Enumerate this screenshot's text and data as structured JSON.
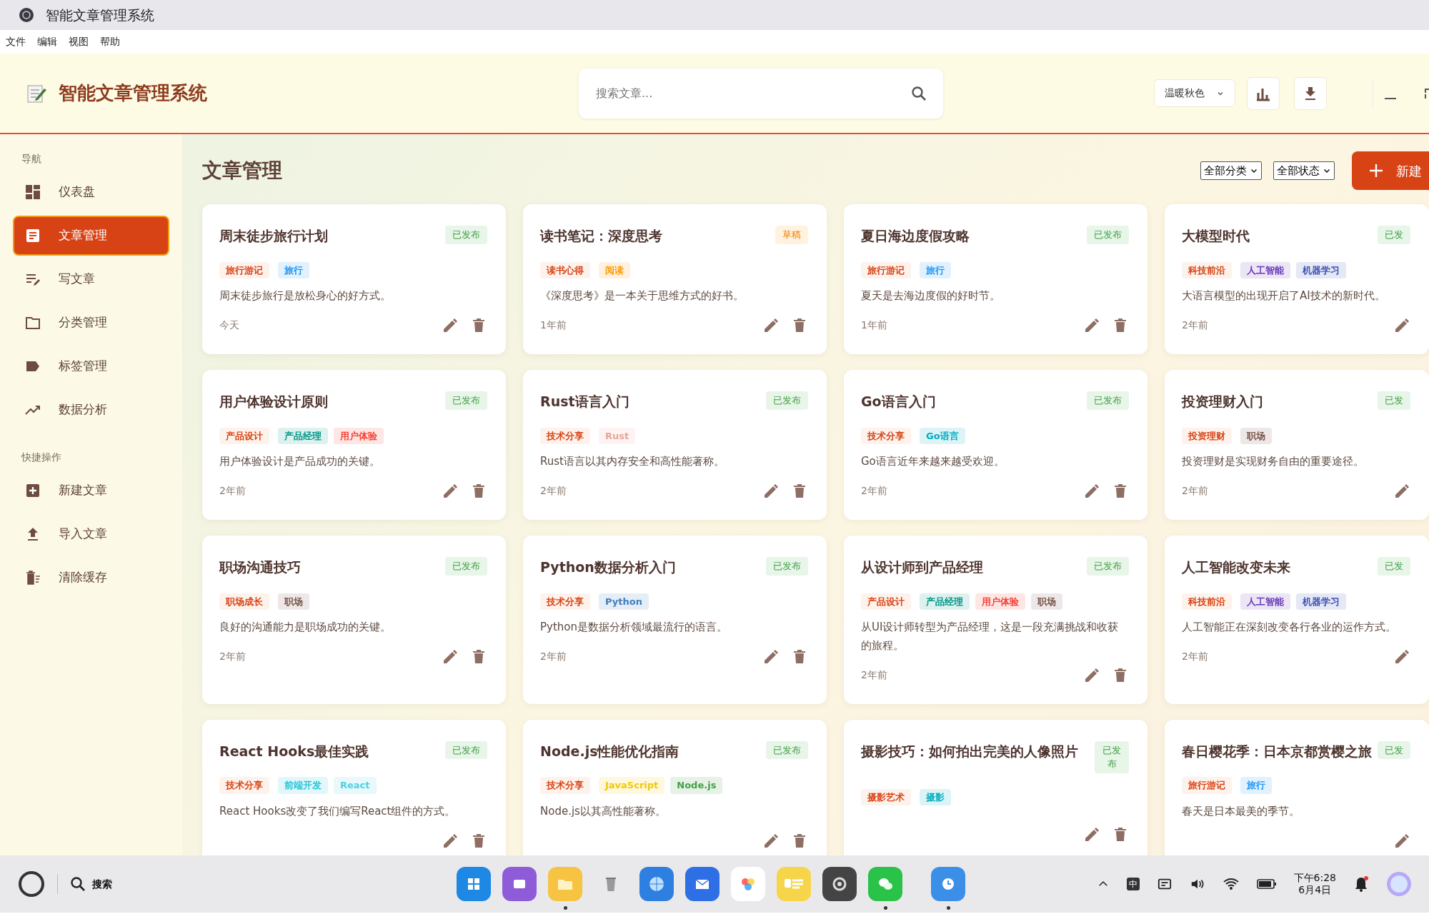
{
  "window": {
    "title": "智能文章管理系统"
  },
  "menu": [
    "文件",
    "编辑",
    "视图",
    "帮助"
  ],
  "header": {
    "app_name": "智能文章管理系统",
    "search": {
      "placeholder": "搜索文章..."
    },
    "theme_select": "温暖秋色"
  },
  "sidebar": {
    "sections": [
      {
        "heading": "导航",
        "items": [
          {
            "label": "仪表盘",
            "kind": "dashboard",
            "selected": false
          },
          {
            "label": "文章管理",
            "kind": "article",
            "selected": true
          },
          {
            "label": "写文章",
            "kind": "write",
            "selected": false
          },
          {
            "label": "分类管理",
            "kind": "folder",
            "selected": false
          },
          {
            "label": "标签管理",
            "kind": "tag",
            "selected": false
          },
          {
            "label": "数据分析",
            "kind": "trend",
            "selected": false
          }
        ]
      },
      {
        "heading": "快捷操作",
        "items": [
          {
            "label": "新建文章",
            "kind": "plus",
            "selected": false
          },
          {
            "label": "导入文章",
            "kind": "upload",
            "selected": false
          },
          {
            "label": "清除缓存",
            "kind": "clear",
            "selected": false
          }
        ]
      }
    ]
  },
  "main": {
    "title": "文章管理",
    "filters": [
      "全部分类",
      "全部状态"
    ],
    "new_button": "新建"
  },
  "cards": [
    {
      "title": "周末徒步旅行计划",
      "status": {
        "text": "已发布",
        "kind": "published"
      },
      "category": "旅行游记",
      "tags": [
        {
          "text": "旅行",
          "color": "#2196f3"
        }
      ],
      "summary": "周末徒步旅行是放松身心的好方式。",
      "time": "今天",
      "kind": "full"
    },
    {
      "title": "读书笔记：深度思考",
      "status": {
        "text": "草稿",
        "kind": "draft"
      },
      "category": "读书心得",
      "tags": [
        {
          "text": "阅读",
          "color": "#ff9800"
        }
      ],
      "summary": "《深度思考》是一本关于思维方式的好书。",
      "time": "1年前",
      "kind": "full"
    },
    {
      "title": "夏日海边度假攻略",
      "status": {
        "text": "已发布",
        "kind": "published"
      },
      "category": "旅行游记",
      "tags": [
        {
          "text": "旅行",
          "color": "#2196f3"
        }
      ],
      "summary": "夏天是去海边度假的好时节。",
      "time": "1年前",
      "kind": "full"
    },
    {
      "title": "大模型时代",
      "status": {
        "text": "已发",
        "kind": "published"
      },
      "category": "科技前沿",
      "tags": [
        {
          "text": "人工智能",
          "color": "#673ab7"
        },
        {
          "text": "机器学习",
          "color": "#3f51b5"
        }
      ],
      "summary": "大语言模型的出现开启了AI技术的新时代。",
      "time": "2年前",
      "kind": "partial"
    },
    {
      "title": "用户体验设计原则",
      "status": {
        "text": "已发布",
        "kind": "published"
      },
      "category": "产品设计",
      "tags": [
        {
          "text": "产品经理",
          "color": "#009688"
        },
        {
          "text": "用户体验",
          "color": "#f44336"
        }
      ],
      "summary": "用户体验设计是产品成功的关键。",
      "time": "2年前",
      "kind": "full"
    },
    {
      "title": "Rust语言入门",
      "status": {
        "text": "已发布",
        "kind": "published"
      },
      "category": "技术分享",
      "tags": [
        {
          "text": "Rust",
          "color": "#e8a69a"
        }
      ],
      "summary": "Rust语言以其内存安全和高性能著称。",
      "time": "2年前",
      "kind": "full"
    },
    {
      "title": "Go语言入门",
      "status": {
        "text": "已发布",
        "kind": "published"
      },
      "category": "技术分享",
      "tags": [
        {
          "text": "Go语言",
          "color": "#00acc1"
        }
      ],
      "summary": "Go语言近年来越来越受欢迎。",
      "time": "2年前",
      "kind": "full"
    },
    {
      "title": "投资理财入门",
      "status": {
        "text": "已发",
        "kind": "published"
      },
      "category": "投资理财",
      "tags": [
        {
          "text": "职场",
          "color": "#795548"
        }
      ],
      "summary": "投资理财是实现财务自由的重要途径。",
      "time": "2年前",
      "kind": "partial"
    },
    {
      "title": "职场沟通技巧",
      "status": {
        "text": "已发布",
        "kind": "published"
      },
      "category": "职场成长",
      "tags": [
        {
          "text": "职场",
          "color": "#795548"
        }
      ],
      "summary": "良好的沟通能力是职场成功的关键。",
      "time": "2年前",
      "kind": "full"
    },
    {
      "title": "Python数据分析入门",
      "status": {
        "text": "已发布",
        "kind": "published"
      },
      "category": "技术分享",
      "tags": [
        {
          "text": "Python",
          "color": "#3f7fbf"
        }
      ],
      "summary": "Python是数据分析领域最流行的语言。",
      "time": "2年前",
      "kind": "full"
    },
    {
      "title": "从设计师到产品经理",
      "status": {
        "text": "已发布",
        "kind": "published"
      },
      "category": "产品设计",
      "tags": [
        {
          "text": "产品经理",
          "color": "#009688"
        },
        {
          "text": "用户体验",
          "color": "#f44336"
        },
        {
          "text": "职场",
          "color": "#795548"
        }
      ],
      "summary": "从UI设计师转型为产品经理，这是一段充满挑战和收获的旅程。",
      "time": "2年前",
      "kind": "full"
    },
    {
      "title": "人工智能改变未来",
      "status": {
        "text": "已发",
        "kind": "published"
      },
      "category": "科技前沿",
      "tags": [
        {
          "text": "人工智能",
          "color": "#673ab7"
        },
        {
          "text": "机器学习",
          "color": "#3f51b5"
        }
      ],
      "summary": "人工智能正在深刻改变各行各业的运作方式。",
      "time": "2年前",
      "kind": "partial"
    },
    {
      "title": "React Hooks最佳实践",
      "status": {
        "text": "已发布",
        "kind": "published"
      },
      "category": "技术分享",
      "tags": [
        {
          "text": "前端开发",
          "color": "#26c6da"
        },
        {
          "text": "React",
          "color": "#4dd0e1"
        }
      ],
      "summary": "React Hooks改变了我们编写React组件的方式。",
      "kind": "full"
    },
    {
      "title": "Node.js性能优化指南",
      "status": {
        "text": "已发布",
        "kind": "published"
      },
      "category": "技术分享",
      "tags": [
        {
          "text": "JavaScript",
          "color": "#f0c808"
        },
        {
          "text": "Node.js",
          "color": "#43a047"
        }
      ],
      "summary": "Node.js以其高性能著称。",
      "kind": "full"
    },
    {
      "title": "摄影技巧：如何拍出完美的人像照片",
      "status": {
        "text": "已发布",
        "kind": "published"
      },
      "category": "摄影艺术",
      "tags": [
        {
          "text": "摄影",
          "color": "#00acc1"
        }
      ],
      "kind": "full"
    },
    {
      "title": "春日樱花季：日本京都赏樱之旅",
      "status": {
        "text": "已发",
        "kind": "published"
      },
      "category": "旅行游记",
      "tags": [
        {
          "text": "旅行",
          "color": "#2196f3"
        }
      ],
      "summary": "春天是日本最美的季节。",
      "kind": "partial"
    }
  ],
  "taskbar": {
    "search_label": "搜索",
    "apps": [
      {
        "kind": "grid",
        "running": false
      },
      {
        "kind": "window",
        "running": false
      },
      {
        "kind": "folder",
        "running": true
      },
      {
        "kind": "trash",
        "running": false
      },
      {
        "kind": "globe",
        "running": false
      },
      {
        "kind": "mail",
        "running": false
      },
      {
        "kind": "photos",
        "running": false
      },
      {
        "kind": "notes",
        "running": false
      },
      {
        "kind": "settings",
        "running": false
      },
      {
        "kind": "chat",
        "running": true
      },
      {
        "kind": "clock",
        "running": true
      }
    ],
    "ime": "中",
    "time": "下午6:28",
    "date": "6月4日"
  }
}
